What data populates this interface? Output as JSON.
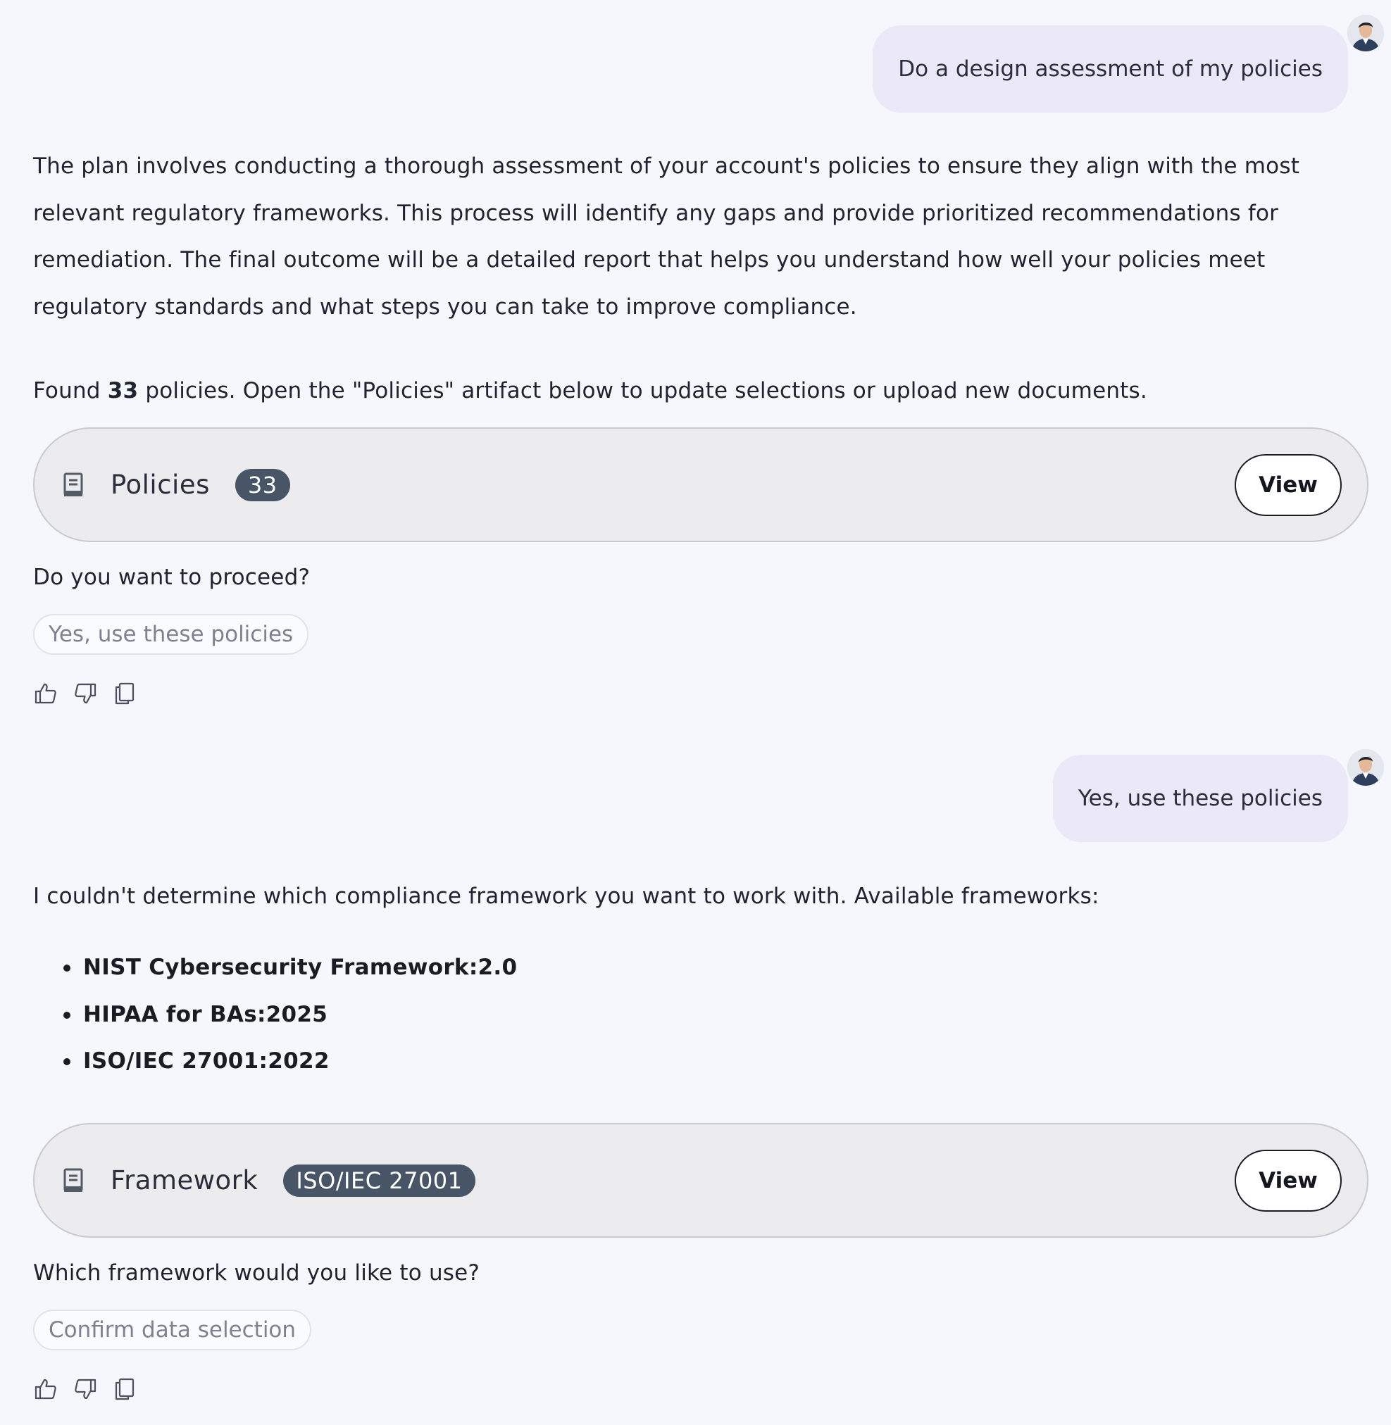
{
  "messages": {
    "user_1": "Do a design assessment of my policies",
    "assistant_1": {
      "plan_paragraph": "The plan involves conducting a thorough assessment of your account's policies to ensure they align with the most relevant regulatory frameworks. This process will identify any gaps and provide prioritized recommendations for remediation. The final outcome will be a detailed report that helps you understand how well your policies meet regulatory standards and what steps you can take to improve compliance.",
      "found_prefix": "Found ",
      "found_count": "33",
      "found_suffix": " policies. Open the \"Policies\" artifact below to update selections or upload new documents.",
      "artifact": {
        "icon": "document-icon",
        "title": "Policies",
        "badge": "33",
        "view_label": "View"
      },
      "question": "Do you want to proceed?",
      "suggestion": "Yes, use these policies"
    },
    "user_2": "Yes, use these policies",
    "assistant_2": {
      "intro": "I couldn't determine which compliance framework you want to work with. Available frameworks:",
      "frameworks": [
        "NIST Cybersecurity Framework:2.0",
        "HIPAA for BAs:2025",
        "ISO/IEC 27001:2022"
      ],
      "artifact": {
        "icon": "document-icon",
        "title": "Framework",
        "badge": "ISO/IEC 27001",
        "view_label": "View"
      },
      "question": "Which framework would you like to use?",
      "suggestion": "Confirm data selection"
    }
  },
  "feedback_actions": [
    "thumbs-up-icon",
    "thumbs-down-icon",
    "copy-icon"
  ],
  "colors": {
    "background": "#f6f7fc",
    "user_bubble": "#ebe8f8",
    "artifact_bg": "#ececef",
    "badge_bg": "#475566",
    "text": "#1f2330"
  }
}
